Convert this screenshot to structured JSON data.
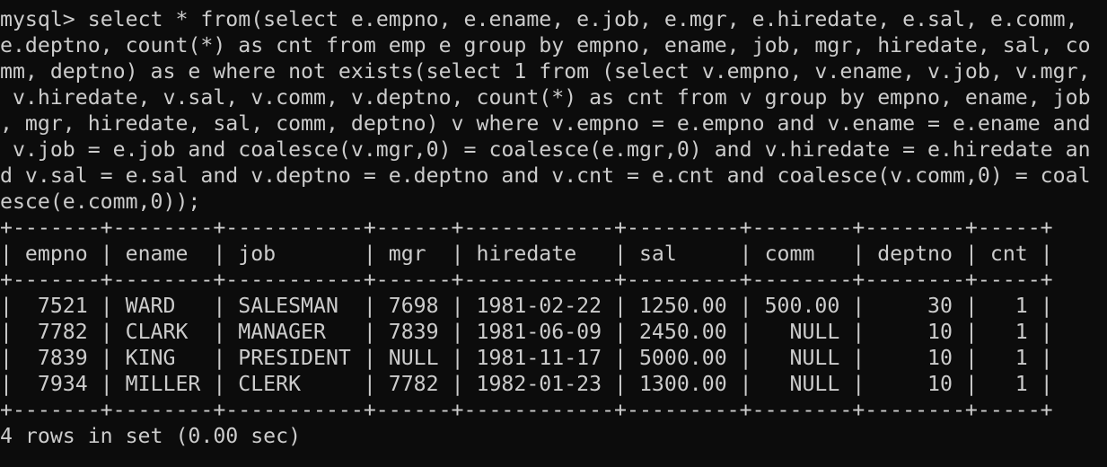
{
  "terminal": {
    "prompt": "mysql> ",
    "query_lines": [
      "select * from(select e.empno, e.ename, e.job, e.mgr, e.hiredate, e.sal, e.comm,",
      "e.deptno, count(*) as cnt from emp e group by empno, ename, job, mgr, hiredate, sal, co",
      "mm, deptno) as e where not exists(select 1 from (select v.empno, v.ename, v.job, v.mgr,",
      " v.hiredate, v.sal, v.comm, v.deptno, count(*) as cnt from v group by empno, ename, job",
      ", mgr, hiredate, sal, comm, deptno) v where v.empno = e.empno and v.ename = e.ename and",
      " v.job = e.job and coalesce(v.mgr,0) = coalesce(e.mgr,0) and v.hiredate = e.hiredate an",
      "d v.sal = e.sal and v.deptno = e.deptno and v.cnt = e.cnt and coalesce(v.comm,0) = coal",
      "esce(e.comm,0));"
    ],
    "result": {
      "columns": [
        "empno",
        "ename",
        "job",
        "mgr",
        "hiredate",
        "sal",
        "comm",
        "deptno",
        "cnt"
      ],
      "align": [
        "r",
        "l",
        "l",
        "l",
        "l",
        "l",
        "r",
        "r",
        "r"
      ],
      "rows": [
        [
          "7521",
          "WARD",
          "SALESMAN",
          "7698",
          "1981-02-22",
          "1250.00",
          "500.00",
          "30",
          "1"
        ],
        [
          "7782",
          "CLARK",
          "MANAGER",
          "7839",
          "1981-06-09",
          "2450.00",
          "NULL",
          "10",
          "1"
        ],
        [
          "7839",
          "KING",
          "PRESIDENT",
          "NULL",
          "1981-11-17",
          "5000.00",
          "NULL",
          "10",
          "1"
        ],
        [
          "7934",
          "MILLER",
          "CLERK",
          "7782",
          "1982-01-23",
          "1300.00",
          "NULL",
          "10",
          "1"
        ]
      ]
    },
    "status": "4 rows in set (0.00 sec)"
  }
}
